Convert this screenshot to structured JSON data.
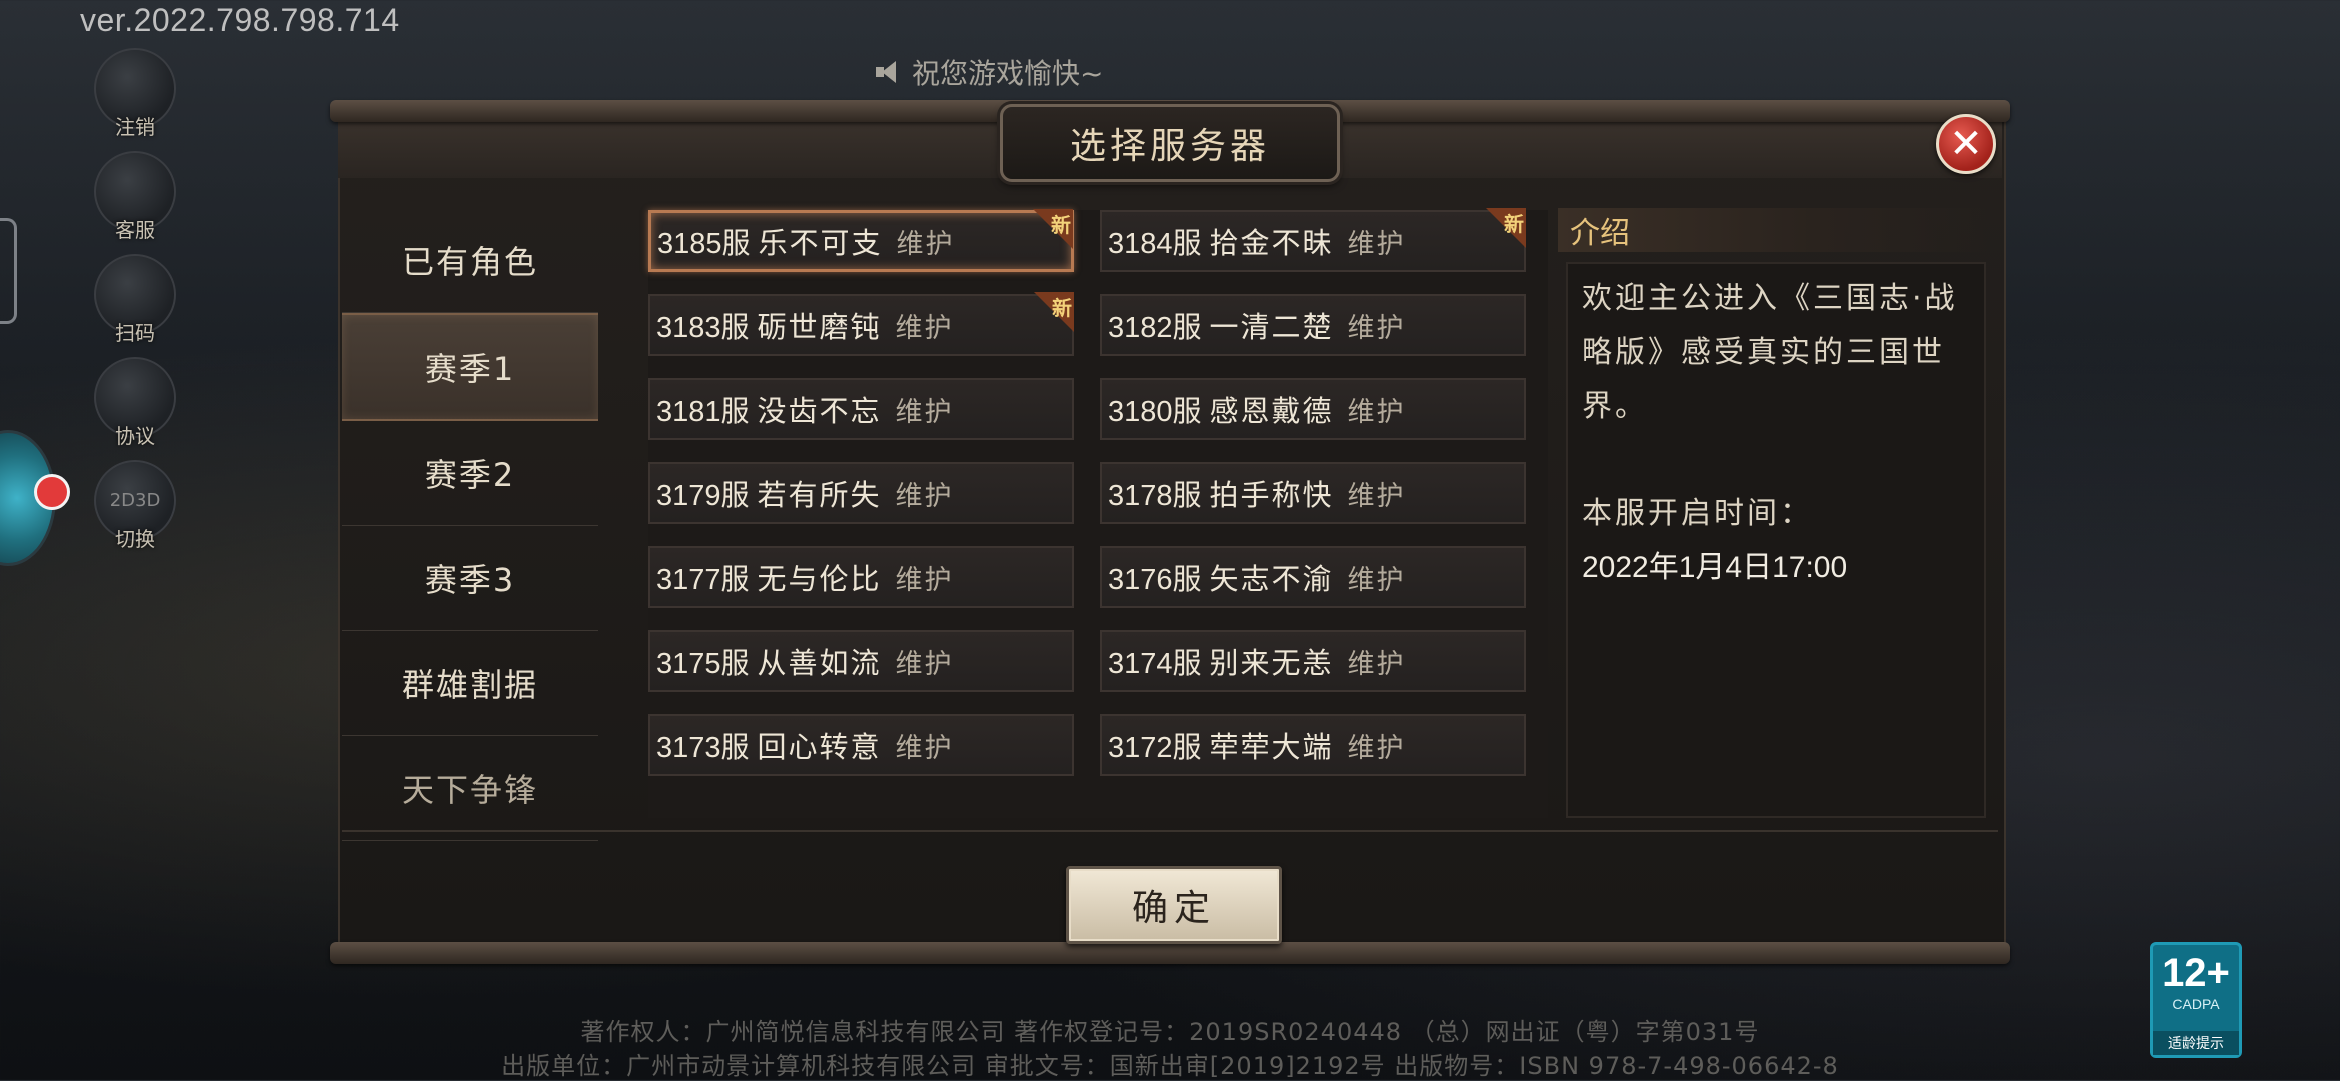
{
  "version": "ver.2022.798.798.714",
  "notice": "祝您游戏愉快~",
  "side_buttons": [
    {
      "label": "注销",
      "icon": "user-logout-icon"
    },
    {
      "label": "客服",
      "icon": "customer-service-icon"
    },
    {
      "label": "扫码",
      "icon": "scan-qr-icon"
    },
    {
      "label": "协议",
      "icon": "agreement-icon"
    },
    {
      "label": "切换",
      "icon": "switch-2d-3d-icon",
      "glyph": "2D3D"
    }
  ],
  "dialog": {
    "title": "选择服务器",
    "close_glyph": "✕",
    "confirm_label": "确定",
    "tabs": [
      "已有角色",
      "赛季1",
      "赛季2",
      "赛季3",
      "群雄割据",
      "天下争锋"
    ],
    "active_tab": "赛季1",
    "servers": [
      {
        "num": "3185服",
        "name": "乐不可支",
        "status": "维护",
        "new": true,
        "selected": true
      },
      {
        "num": "3184服",
        "name": "拾金不昧",
        "status": "维护",
        "new": true
      },
      {
        "num": "3183服",
        "name": "砺世磨钝",
        "status": "维护",
        "new": true
      },
      {
        "num": "3182服",
        "name": "一清二楚",
        "status": "维护"
      },
      {
        "num": "3181服",
        "name": "没齿不忘",
        "status": "维护"
      },
      {
        "num": "3180服",
        "name": "感恩戴德",
        "status": "维护"
      },
      {
        "num": "3179服",
        "name": "若有所失",
        "status": "维护"
      },
      {
        "num": "3178服",
        "name": "拍手称快",
        "status": "维护"
      },
      {
        "num": "3177服",
        "name": "无与伦比",
        "status": "维护"
      },
      {
        "num": "3176服",
        "name": "矢志不渝",
        "status": "维护"
      },
      {
        "num": "3175服",
        "name": "从善如流",
        "status": "维护"
      },
      {
        "num": "3174服",
        "name": "别来无恙",
        "status": "维护"
      },
      {
        "num": "3173服",
        "name": "回心转意",
        "status": "维护"
      },
      {
        "num": "3172服",
        "name": "荦荦大端",
        "status": "维护"
      }
    ],
    "new_badge": "新",
    "intro": {
      "title": "介绍",
      "text": "欢迎主公进入《三国志·战略版》感受真实的三国世界。",
      "open_label": "本服开启时间：",
      "open_time": "2022年1月4日17:00"
    }
  },
  "footer": {
    "line1": "著作权人：广州简悦信息科技有限公司    著作权登记号：2019SR0240448    （总）网出证（粤）字第031号",
    "line2": "出版单位：广州市动景计算机科技有限公司 审批文号：国新出审[2019]2192号 出版物号：ISBN 978-7-498-06642-8"
  },
  "age_rating": {
    "number": "12+",
    "org": "CADPA",
    "tip": "适龄提示"
  },
  "colors": {
    "accent": "#e6c27c",
    "selected_border": "#b87a52",
    "new_badge": "#7a3a1e",
    "close": "#a3221b"
  }
}
